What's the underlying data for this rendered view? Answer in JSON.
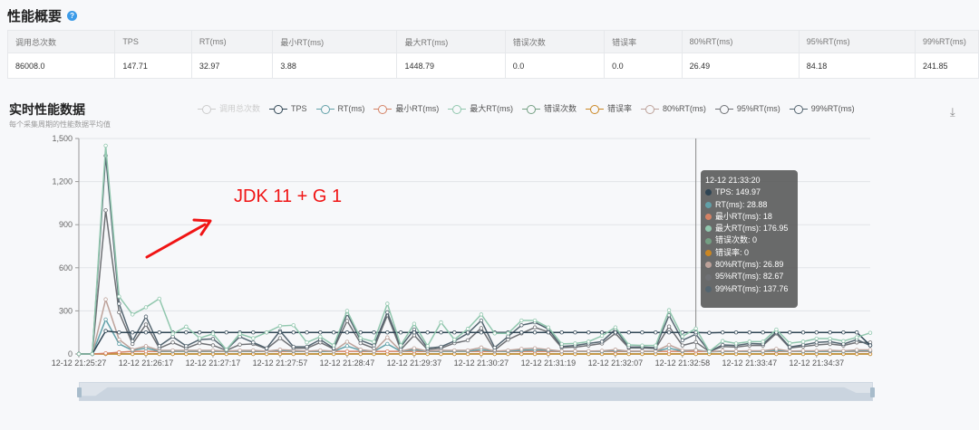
{
  "summary": {
    "title": "性能概要",
    "help_icon": "question-circle-icon",
    "columns": [
      "调用总次数",
      "TPS",
      "RT(ms)",
      "最小RT(ms)",
      "最大RT(ms)",
      "错误次数",
      "错误率",
      "80%RT(ms)",
      "95%RT(ms)",
      "99%RT(ms)"
    ],
    "values": [
      "86008.0",
      "147.71",
      "32.97",
      "3.88",
      "1448.79",
      "0.0",
      "0.0",
      "26.49",
      "84.18",
      "241.85"
    ]
  },
  "realtime": {
    "title": "实时性能数据",
    "subtitle": "每个采集周期的性能数据平均值",
    "download_icon": "download-icon",
    "annotation": "JDK 11 + G 1",
    "annotation_color": "#f01414"
  },
  "tooltip": {
    "time": "12-12 21:33:20",
    "rows": [
      {
        "label": "TPS: 149.97",
        "color": "#2f4554"
      },
      {
        "label": "RT(ms): 28.88",
        "color": "#61a0a8"
      },
      {
        "label": "最小RT(ms): 18",
        "color": "#d48265"
      },
      {
        "label": "最大RT(ms): 176.95",
        "color": "#91c7ae"
      },
      {
        "label": "错误次数: 0",
        "color": "#749f83"
      },
      {
        "label": "错误率: 0",
        "color": "#ca8622"
      },
      {
        "label": "80%RT(ms): 26.89",
        "color": "#bda29a"
      },
      {
        "label": "95%RT(ms): 82.67",
        "color": "#6e7074"
      },
      {
        "label": "99%RT(ms): 137.76",
        "color": "#546570"
      }
    ]
  },
  "chart_data": {
    "type": "line",
    "ylim": [
      0,
      1500
    ],
    "yticks": [
      "0",
      "300",
      "600",
      "900",
      "1,200",
      "1,500"
    ],
    "ytick_values": [
      0,
      300,
      600,
      900,
      1200,
      1500
    ],
    "grid": true,
    "legend_position": "top",
    "xtick_labels": [
      "12-12 21:25:27",
      "12-12 21:26:17",
      "12-12 21:27:17",
      "12-12 21:27:57",
      "12-12 21:28:47",
      "12-12 21:29:37",
      "12-12 21:30:27",
      "12-12 21:31:19",
      "12-12 21:32:07",
      "12-12 21:32:58",
      "12-12 21:33:47",
      "12-12 21:34:37"
    ],
    "hover_time": "12-12 21:33:20",
    "series": [
      {
        "name": "调用总次数",
        "color": "#c23531",
        "enabled": false,
        "values": []
      },
      {
        "name": "TPS",
        "color": "#2f4554",
        "enabled": true,
        "values": [
          0,
          0,
          160,
          150,
          150,
          150,
          150,
          150,
          150,
          150,
          150,
          150,
          150,
          150,
          150,
          150,
          150,
          150,
          150,
          150,
          150,
          150,
          150,
          150,
          150,
          150,
          150,
          150,
          150,
          150,
          150,
          150,
          150,
          150,
          150,
          150,
          150,
          150,
          150,
          150,
          150,
          150,
          150,
          150,
          150,
          150,
          149.97,
          147,
          150,
          150,
          150,
          150,
          150,
          150,
          150,
          150,
          150,
          150,
          150,
          60
        ]
      },
      {
        "name": "RT(ms)",
        "color": "#61a0a8",
        "enabled": true,
        "values": [
          0,
          0,
          240,
          70,
          25,
          40,
          20,
          20,
          20,
          20,
          20,
          18,
          20,
          20,
          18,
          25,
          20,
          18,
          20,
          18,
          55,
          25,
          18,
          70,
          18,
          30,
          18,
          20,
          20,
          20,
          30,
          18,
          20,
          25,
          28,
          25,
          18,
          18,
          18,
          18,
          25,
          18,
          18,
          18,
          40,
          20,
          28.88,
          15,
          18,
          18,
          18,
          18,
          25,
          18,
          18,
          18,
          20,
          18,
          22,
          22
        ]
      },
      {
        "name": "最小RT(ms)",
        "color": "#d48265",
        "enabled": true,
        "values": [
          0,
          0,
          5,
          12,
          18,
          18,
          17,
          18,
          18,
          17,
          18,
          18,
          18,
          17,
          18,
          18,
          18,
          17,
          18,
          18,
          18,
          18,
          17,
          18,
          18,
          18,
          17,
          18,
          18,
          18,
          18,
          17,
          18,
          18,
          18,
          18,
          17,
          18,
          18,
          18,
          18,
          17,
          18,
          18,
          18,
          18,
          18,
          17,
          18,
          18,
          18,
          17,
          18,
          18,
          18,
          17,
          18,
          18,
          18,
          18
        ]
      },
      {
        "name": "最大RT(ms)",
        "color": "#91c7ae",
        "enabled": true,
        "values": [
          0,
          0,
          1450,
          400,
          275,
          325,
          385,
          140,
          190,
          110,
          140,
          30,
          140,
          110,
          150,
          195,
          200,
          80,
          120,
          60,
          300,
          110,
          85,
          350,
          60,
          210,
          55,
          220,
          100,
          175,
          275,
          143,
          143,
          233,
          233,
          185,
          70,
          73,
          86,
          126,
          185,
          63,
          59,
          59,
          305,
          122,
          176.95,
          17,
          90,
          73,
          86,
          86,
          170,
          75,
          86,
          107,
          107,
          90,
          116,
          147
        ]
      },
      {
        "name": "错误次数",
        "color": "#749f83",
        "enabled": true,
        "values": [
          0,
          0,
          0,
          0,
          0,
          0,
          0,
          0,
          0,
          0,
          0,
          0,
          0,
          0,
          0,
          0,
          0,
          0,
          0,
          0,
          0,
          0,
          0,
          0,
          0,
          0,
          0,
          0,
          0,
          0,
          0,
          0,
          0,
          0,
          0,
          0,
          0,
          0,
          0,
          0,
          0,
          0,
          0,
          0,
          0,
          0,
          0,
          0,
          0,
          0,
          0,
          0,
          0,
          0,
          0,
          0,
          0,
          0,
          0,
          0
        ]
      },
      {
        "name": "错误率",
        "color": "#ca8622",
        "enabled": true,
        "values": [
          0,
          0,
          0,
          0,
          0,
          0,
          0,
          0,
          0,
          0,
          0,
          0,
          0,
          0,
          0,
          0,
          0,
          0,
          0,
          0,
          0,
          0,
          0,
          0,
          0,
          0,
          0,
          0,
          0,
          0,
          0,
          0,
          0,
          0,
          0,
          0,
          0,
          0,
          0,
          0,
          0,
          0,
          0,
          0,
          0,
          0,
          0,
          0,
          0,
          0,
          0,
          0,
          0,
          0,
          0,
          0,
          0,
          0,
          0,
          0
        ]
      },
      {
        "name": "80%RT(ms)",
        "color": "#bda29a",
        "enabled": true,
        "values": [
          0,
          0,
          380,
          100,
          30,
          55,
          25,
          25,
          25,
          25,
          25,
          20,
          25,
          25,
          20,
          30,
          25,
          20,
          25,
          20,
          85,
          30,
          20,
          115,
          20,
          40,
          20,
          25,
          25,
          25,
          45,
          20,
          25,
          35,
          40,
          30,
          20,
          20,
          20,
          22,
          30,
          20,
          20,
          20,
          63,
          25,
          26.89,
          15,
          22,
          20,
          22,
          22,
          35,
          20,
          22,
          22,
          25,
          22,
          28,
          28
        ]
      },
      {
        "name": "95%RT(ms)",
        "color": "#6e7074",
        "enabled": true,
        "values": [
          0,
          0,
          1000,
          290,
          70,
          205,
          40,
          80,
          40,
          75,
          60,
          25,
          65,
          70,
          35,
          110,
          40,
          40,
          80,
          35,
          230,
          75,
          40,
          270,
          30,
          130,
          30,
          40,
          75,
          95,
          180,
          27,
          100,
          143,
          185,
          153,
          44,
          48,
          59,
          73,
          143,
          42,
          42,
          38,
          191,
          59,
          82.67,
          17,
          52,
          48,
          59,
          59,
          143,
          42,
          52,
          63,
          69,
          59,
          80,
          80
        ]
      },
      {
        "name": "99%RT(ms)",
        "color": "#546570",
        "enabled": true,
        "values": [
          0,
          0,
          1380,
          350,
          90,
          260,
          55,
          120,
          55,
          100,
          105,
          30,
          120,
          80,
          40,
          160,
          50,
          50,
          100,
          40,
          280,
          95,
          60,
          290,
          50,
          170,
          40,
          50,
          90,
          143,
          233,
          44,
          122,
          200,
          220,
          174,
          52,
          59,
          73,
          86,
          170,
          48,
          48,
          44,
          269,
          95,
          137.76,
          17,
          63,
          59,
          73,
          69,
          153,
          48,
          63,
          80,
          86,
          69,
          100,
          59
        ]
      }
    ]
  }
}
